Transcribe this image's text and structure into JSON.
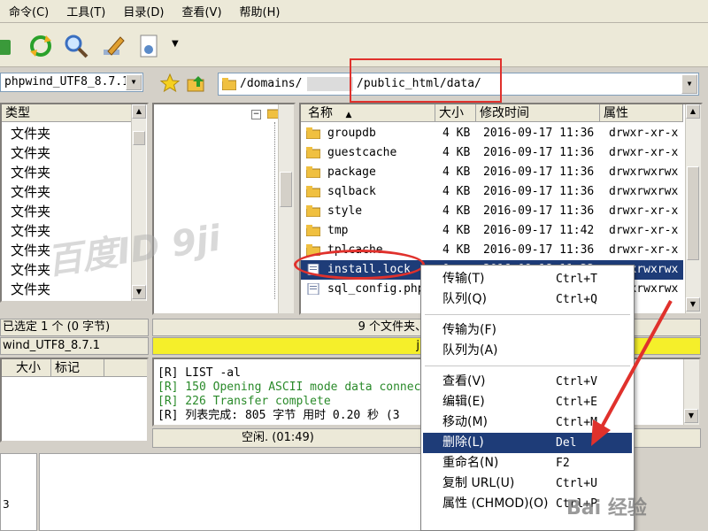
{
  "menubar": [
    "命令(C)",
    "工具(T)",
    "目录(D)",
    "查看(V)",
    "帮助(H)"
  ],
  "left_panel": {
    "path": "phpwind_UTF8_8.7.1",
    "type_header": "类型",
    "types": [
      "文件夹",
      "文件夹",
      "文件夹",
      "文件夹",
      "文件夹",
      "文件夹",
      "文件夹",
      "文件夹",
      "文件夹"
    ],
    "status_selected": "已选定 1 个 (0 字节)",
    "status_path": "wind_UTF8_8.7.1",
    "col_size": "大小",
    "col_mark": "标记"
  },
  "address": {
    "prefix": "/domains/",
    "suffix": "/public_html/data/"
  },
  "file_list": {
    "headers": {
      "name": "名称",
      "size": "大小",
      "modified": "修改时间",
      "attr": "属性"
    },
    "rows": [
      {
        "name": "groupdb",
        "size": "4 KB",
        "modified": "2016-09-17 11:36",
        "attr": "drwxr-xr-x"
      },
      {
        "name": "guestcache",
        "size": "4 KB",
        "modified": "2016-09-17 11:36",
        "attr": "drwxr-xr-x"
      },
      {
        "name": "package",
        "size": "4 KB",
        "modified": "2016-09-17 11:36",
        "attr": "drwxrwxrwx"
      },
      {
        "name": "sqlback",
        "size": "4 KB",
        "modified": "2016-09-17 11:36",
        "attr": "drwxrwxrwx"
      },
      {
        "name": "style",
        "size": "4 KB",
        "modified": "2016-09-17 11:36",
        "attr": "drwxr-xr-x"
      },
      {
        "name": "tmp",
        "size": "4 KB",
        "modified": "2016-09-17 11:42",
        "attr": "drwxr-xr-x"
      },
      {
        "name": "tplcache",
        "size": "4 KB",
        "modified": "2016-09-17 11:36",
        "attr": "drwxr-xr-x"
      },
      {
        "name": "install.lock",
        "size": "0",
        "modified": "2016-09-18 11:22",
        "attr": "-rwxrwxrwx"
      },
      {
        "name": "sql_config.php",
        "size": "",
        "modified": "",
        "attr": "-rwxrwxrwx"
      }
    ],
    "status": "9 个文件夹、2 个文件、总",
    "status2": "jpfz"
  },
  "log": {
    "lines": [
      "[R] LIST -al",
      "[R] 150 Opening ASCII mode data connection",
      "[R] 226 Transfer complete",
      "[R] 列表完成: 805 字节 用时 0.20 秒 (3"
    ]
  },
  "bottom_status": "空闲. (01:49)",
  "context_menu": {
    "groups": [
      [
        {
          "label": "传输(T)",
          "shortcut": "Ctrl+T"
        },
        {
          "label": "队列(Q)",
          "shortcut": "Ctrl+Q"
        }
      ],
      [
        {
          "label": "传输为(F)",
          "shortcut": ""
        },
        {
          "label": "队列为(A)",
          "shortcut": ""
        }
      ],
      [
        {
          "label": "查看(V)",
          "shortcut": "Ctrl+V"
        },
        {
          "label": "编辑(E)",
          "shortcut": "Ctrl+E"
        },
        {
          "label": "移动(M)",
          "shortcut": "Ctrl+M"
        },
        {
          "label": "删除(L)",
          "shortcut": "Del"
        },
        {
          "label": "重命名(N)",
          "shortcut": "F2"
        },
        {
          "label": "复制 URL(U)",
          "shortcut": "Ctrl+U"
        },
        {
          "label": "属性 (CHMOD)(O)",
          "shortcut": "Ctrl+P"
        }
      ]
    ]
  },
  "watermarks": {
    "baidu_id": "百度ID 9ji",
    "baidu_jingyan": "Bai 经验"
  },
  "colors": {
    "highlight": "#1e3c78",
    "annotation_red": "#e0312c",
    "status_yellow": "#f5ef2a"
  }
}
